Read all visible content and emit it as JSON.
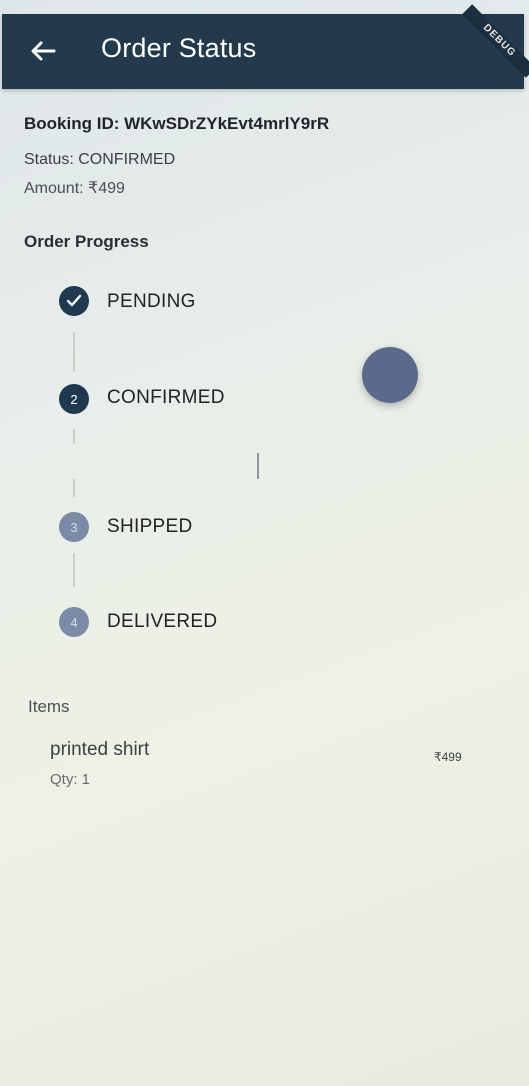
{
  "appbar": {
    "title": "Order Status",
    "debug_label": "DEBUG"
  },
  "order": {
    "booking": "Booking ID: WKwSDrZYkEvt4mrlY9rR",
    "status": "Status: CONFIRMED",
    "amount": "Amount: ₹499"
  },
  "progress": {
    "title": "Order Progress",
    "steps": [
      {
        "label": "PENDING",
        "badge": "✓",
        "state": "done"
      },
      {
        "label": "CONFIRMED",
        "badge": "2",
        "state": "current"
      },
      {
        "label": "SHIPPED",
        "badge": "3",
        "state": "upcoming"
      },
      {
        "label": "DELIVERED",
        "badge": "4",
        "state": "upcoming"
      }
    ]
  },
  "items": {
    "title": "Items",
    "list": [
      {
        "name": "printed shirt",
        "qty": "Qty: 1",
        "price": "₹499"
      }
    ]
  },
  "icons": {
    "back": "arrow-left-icon",
    "check": "check-icon"
  },
  "colors": {
    "appbar": "#233a4d",
    "step_active": "#1f3a4e",
    "step_inactive": "#7b8aa6",
    "fab": "#5b6a8c"
  }
}
